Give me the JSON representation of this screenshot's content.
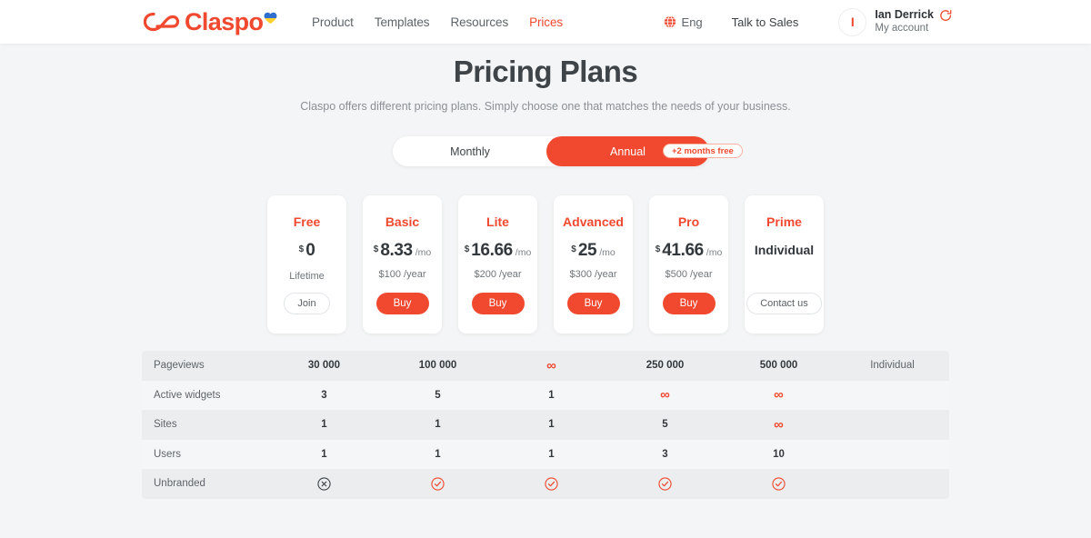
{
  "header": {
    "logo_text": "Claspo",
    "nav": [
      {
        "label": "Product",
        "active": false
      },
      {
        "label": "Templates",
        "active": false
      },
      {
        "label": "Resources",
        "active": false
      },
      {
        "label": "Prices",
        "active": true
      }
    ],
    "language": "Eng",
    "talk_to_sales": "Talk to Sales",
    "avatar_initial": "I",
    "user_name": "Ian Derrick",
    "user_sub": "My account"
  },
  "hero": {
    "title": "Pricing Plans",
    "subtitle": "Claspo offers different pricing plans. Simply choose one that matches the needs of your business."
  },
  "billing_toggle": {
    "monthly_label": "Monthly",
    "annual_label": "Annual",
    "badge": "+2 months free",
    "selected": "Annual"
  },
  "plans": [
    {
      "name": "Free",
      "currency": "$",
      "amount": "0",
      "per": "",
      "note": "Lifetime",
      "cta": "Join",
      "cta_style": "ghost"
    },
    {
      "name": "Basic",
      "currency": "$",
      "amount": "8.33",
      "per": "/mo",
      "note": "$100 /year",
      "cta": "Buy",
      "cta_style": "solid"
    },
    {
      "name": "Lite",
      "currency": "$",
      "amount": "16.66",
      "per": "/mo",
      "note": "$200 /year",
      "cta": "Buy",
      "cta_style": "solid"
    },
    {
      "name": "Advanced",
      "currency": "$",
      "amount": "25",
      "per": "/mo",
      "note": "$300 /year",
      "cta": "Buy",
      "cta_style": "solid"
    },
    {
      "name": "Pro",
      "currency": "$",
      "amount": "41.66",
      "per": "/mo",
      "note": "$500 /year",
      "cta": "Buy",
      "cta_style": "solid"
    },
    {
      "name": "Prime",
      "currency": "",
      "amount": "Individual",
      "per": "",
      "note": "",
      "cta": "Contact us",
      "cta_style": "ghost"
    }
  ],
  "comparison": {
    "rows": [
      {
        "label": "Pageviews",
        "cells": [
          {
            "text": "30 000",
            "kind": "text"
          },
          {
            "text": "100 000",
            "kind": "text"
          },
          {
            "text": "∞",
            "kind": "infinity"
          },
          {
            "text": "250 000",
            "kind": "text"
          },
          {
            "text": "500 000",
            "kind": "text"
          },
          {
            "text": "Individual",
            "kind": "plain"
          }
        ]
      },
      {
        "label": "Active widgets",
        "cells": [
          {
            "text": "3",
            "kind": "text"
          },
          {
            "text": "5",
            "kind": "text"
          },
          {
            "text": "1",
            "kind": "text"
          },
          {
            "text": "∞",
            "kind": "infinity"
          },
          {
            "text": "∞",
            "kind": "infinity"
          },
          {
            "text": "",
            "kind": "empty"
          }
        ]
      },
      {
        "label": "Sites",
        "cells": [
          {
            "text": "1",
            "kind": "text"
          },
          {
            "text": "1",
            "kind": "text"
          },
          {
            "text": "1",
            "kind": "text"
          },
          {
            "text": "5",
            "kind": "text"
          },
          {
            "text": "∞",
            "kind": "infinity"
          },
          {
            "text": "",
            "kind": "empty"
          }
        ]
      },
      {
        "label": "Users",
        "cells": [
          {
            "text": "1",
            "kind": "text"
          },
          {
            "text": "1",
            "kind": "text"
          },
          {
            "text": "1",
            "kind": "text"
          },
          {
            "text": "3",
            "kind": "text"
          },
          {
            "text": "10",
            "kind": "text"
          },
          {
            "text": "",
            "kind": "empty"
          }
        ]
      },
      {
        "label": "Unbranded",
        "cells": [
          {
            "text": "",
            "kind": "cross"
          },
          {
            "text": "",
            "kind": "check"
          },
          {
            "text": "",
            "kind": "check"
          },
          {
            "text": "",
            "kind": "check"
          },
          {
            "text": "",
            "kind": "check"
          },
          {
            "text": "",
            "kind": "empty"
          }
        ]
      }
    ]
  },
  "colors": {
    "accent": "#f0492f",
    "page_bg": "#f4f5f6",
    "row_dark": "#ebedee",
    "row_light": "#f5f6f7",
    "text_dark": "#33383c",
    "text_muted": "#5e6469"
  }
}
